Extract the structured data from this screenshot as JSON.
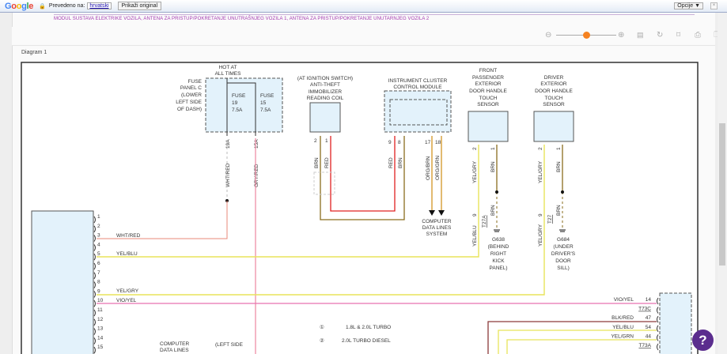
{
  "translate_bar": {
    "logo": "Google",
    "translated_to": "Prevedeno na:",
    "language": "hrvatski",
    "show_original": "Prikaži original",
    "options": "Opcije ▼",
    "close": "×"
  },
  "header_text": {
    "line2": "MODUL SUSTAVA ELEKTRIKE VOZILA, ANTENA ZA PRISTUP/POKRETANJE UNUTRAŠNJEG VOZILA 1, ANTENA ZA PRISTUP/POKRETANJE UNUTARNJEG VOZILA 2"
  },
  "toolbar": {
    "zoom_out": "⊖",
    "zoom_in": "⊕",
    "zoom_level": 0.5,
    "accent": "#f58220"
  },
  "diagram_title": "Diagram 1",
  "diagram": {
    "hot": [
      "HOT AT",
      "ALL TIMES"
    ],
    "fuse_panel": [
      "FUSE",
      "PANEL C",
      "(LOWER",
      "LEFT SIDE",
      "OF DASH)"
    ],
    "fuse19": [
      "FUSE",
      "19",
      "7.5A"
    ],
    "fuse15": [
      "FUSE",
      "15",
      "7.5A"
    ],
    "w19a": "19A",
    "w15a": "15A",
    "wht_red": "WHT/RED",
    "gry_red": "GRY/RED",
    "immobilizer": [
      "(AT IGNITION SWITCH)",
      "ANTI-THEFT",
      "IMMOBILIZER",
      "READING COIL"
    ],
    "imm_pins": {
      "p2": "2",
      "p1": "1",
      "brn": "BRN",
      "red": "RED"
    },
    "cluster": [
      "INSTRUMENT CLUSTER",
      "CONTROL MODULE"
    ],
    "cluster_pins": {
      "p9": "9",
      "p8": "8",
      "p17": "17",
      "p18": "18",
      "red": "RED",
      "brn": "BRN",
      "org_brn": "ORG/BRN",
      "org_grn": "ORG/GRN"
    },
    "cdl": [
      "COMPUTER",
      "DATA LINES",
      "SYSTEM"
    ],
    "front_pass": [
      "FRONT",
      "PASSENGER",
      "EXTERIOR",
      "DOOR HANDLE",
      "TOUCH",
      "SENSOR"
    ],
    "driver": [
      "DRIVER",
      "EXTERIOR",
      "DOOR HANDLE",
      "TOUCH",
      "SENSOR"
    ],
    "fp_wires": {
      "p2": "2",
      "p1": "1",
      "yel_gry": "YEL/GRY",
      "brn": "BRN",
      "brn2": "BRN",
      "p9": "9",
      "yel_blu": "YEL/BLU",
      "conn": "T27A"
    },
    "dr_wires": {
      "p2": "2",
      "p1": "1",
      "yel_gry": "YEL/GRY",
      "brn": "BRN",
      "brn2": "BRN",
      "p9": "9",
      "yel_gry2": "YEL/GRY",
      "conn": "T27"
    },
    "g638": [
      "G638",
      "(BEHIND",
      "RIGHT",
      "KICK",
      "PANEL)"
    ],
    "g684": [
      "G684",
      "(UNDER",
      "DRIVER'S",
      "DOOR",
      "SILL)"
    ],
    "left_pins": [
      "1",
      "2",
      "3",
      "4",
      "5",
      "6",
      "7",
      "8",
      "9",
      "10",
      "11",
      "12",
      "13",
      "14",
      "15"
    ],
    "left_wires": {
      "p3": "WHT/RED",
      "p5": "YEL/BLU",
      "p9": "YEL/GRY",
      "p10": "VIO/YEL"
    },
    "right_rows": [
      {
        "wire": "VIO/YEL",
        "pin": "14"
      },
      {
        "wire": "",
        "pin": "T73C"
      },
      {
        "wire": "BLK/RED",
        "pin": "47"
      },
      {
        "wire": "YEL/BLU",
        "pin": "54"
      },
      {
        "wire": "YEL/GRN",
        "pin": "44"
      },
      {
        "wire": "",
        "pin": "T73A"
      }
    ],
    "legend": [
      {
        "num": "①",
        "text": "1.8L & 2.0L TURBO"
      },
      {
        "num": "②",
        "text": "2.0L TURBO DIESEL"
      }
    ],
    "bottom": {
      "cdl": [
        "COMPUTER",
        "DATA LINES"
      ],
      "left_side": "(LEFT SIDE"
    }
  },
  "help": "?"
}
